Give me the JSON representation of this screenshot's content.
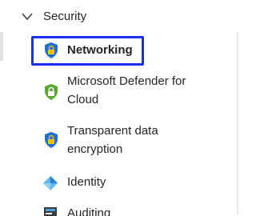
{
  "group": {
    "label": "Security",
    "expanded": true
  },
  "items": [
    {
      "label": "Networking",
      "selected": true,
      "icon": "shield-lock-blue-icon"
    },
    {
      "label_line1": "Microsoft Defender for",
      "label_line2": "Cloud",
      "icon": "shield-lock-green-icon"
    },
    {
      "label_line1": "Transparent data",
      "label_line2": "encryption",
      "icon": "shield-lock-blue-icon"
    },
    {
      "label": "Identity",
      "icon": "identity-diamond-icon"
    },
    {
      "label": "Auditing",
      "icon": "audit-log-icon"
    }
  ],
  "colors": {
    "selection_border": "#1a2ff0",
    "text": "#242424",
    "shield_blue": "#1f6fd6",
    "shield_green": "#5aa832",
    "lock_yellow": "#f2c200"
  }
}
